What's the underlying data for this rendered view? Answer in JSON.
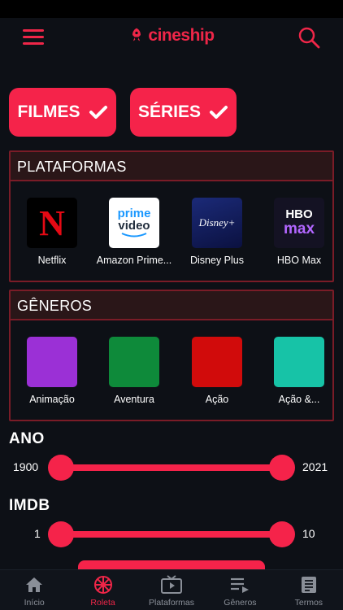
{
  "header": {
    "logo_text": "cineship"
  },
  "types": [
    {
      "label": "FILMES"
    },
    {
      "label": "SÉRIES"
    }
  ],
  "platforms": {
    "title": "PLATAFORMAS",
    "items": [
      {
        "label": "Netflix",
        "tile_text": "N"
      },
      {
        "label": "Amazon Prime...",
        "tile_text_1": "prime",
        "tile_text_2": "video"
      },
      {
        "label": "Disney Plus",
        "tile_text": "Disney+"
      },
      {
        "label": "HBO Max",
        "tile_text_1": "HBO",
        "tile_text_2": "max"
      }
    ]
  },
  "genres": {
    "title": "GÊNEROS",
    "items": [
      {
        "label": "Animação",
        "color": "#9b30d6"
      },
      {
        "label": "Aventura",
        "color": "#0e8a3a"
      },
      {
        "label": "Ação",
        "color": "#d10b0b"
      },
      {
        "label": "Ação &...",
        "color": "#17c3a7"
      }
    ]
  },
  "ano": {
    "title": "ANO",
    "min": "1900",
    "max": "2021",
    "selected_min": 1900,
    "selected_max": 2021
  },
  "imdb": {
    "title": "IMDB",
    "min": "1",
    "max": "10",
    "selected_min": 1,
    "selected_max": 10
  },
  "tabs": [
    {
      "label": "Início",
      "icon": "home-icon"
    },
    {
      "label": "Roleta",
      "icon": "roulette-icon",
      "active": true
    },
    {
      "label": "Plataformas",
      "icon": "tv-icon"
    },
    {
      "label": "Gêneros",
      "icon": "genre-list-icon"
    },
    {
      "label": "Termos",
      "icon": "document-icon"
    }
  ],
  "colors": {
    "accent": "#f5234a",
    "background": "#0d1016",
    "panel_border": "#7a1c27"
  }
}
